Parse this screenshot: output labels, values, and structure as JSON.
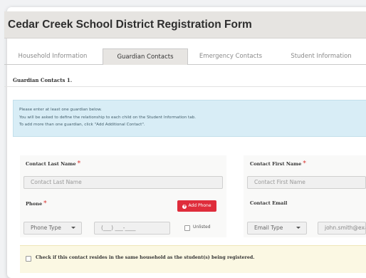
{
  "form": {
    "title": "Cedar Creek School District Registration Form"
  },
  "tabs": [
    {
      "label": "Household Information"
    },
    {
      "label": "Guardian Contacts"
    },
    {
      "label": "Emergency Contacts"
    },
    {
      "label": "Student Information"
    }
  ],
  "active_tab": "Guardian Contacts",
  "section": {
    "label": "Guardian Contacts 1."
  },
  "info": {
    "lines": [
      "Please enter at least one guardian below.",
      "You will be asked to define the relationship to each child on the Student Information tab.",
      "To add more than one guardian, click \"Add Additional Contact\"."
    ]
  },
  "fields": {
    "last_name": {
      "label": "Contact Last Name",
      "required_mark": "*",
      "placeholder": "Contact Last Name"
    },
    "first_name": {
      "label": "Contact First Name",
      "required_mark": "*",
      "placeholder": "Contact First Name"
    },
    "phone": {
      "label": "Phone",
      "required_mark": "*",
      "type_value": "Phone Type",
      "number_placeholder": "(___) ___-____",
      "add_button": "Add Phone",
      "unlisted_label": "Unlisted"
    },
    "email": {
      "label": "Contact Email",
      "type_value": "Email Type",
      "placeholder": "john.smith@exar"
    }
  },
  "household": {
    "label": "Check if this contact resides in the same household as the student(s) being registered."
  }
}
